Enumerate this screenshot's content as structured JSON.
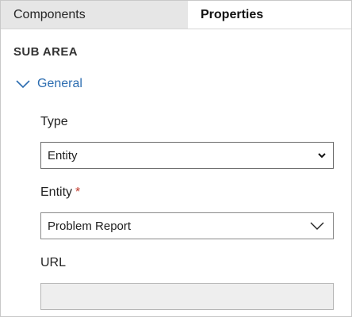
{
  "tabs": {
    "components_label": "Components",
    "properties_label": "Properties"
  },
  "section": {
    "title": "SUB AREA"
  },
  "group": {
    "title": "General",
    "chevron_icon": "chevron-down-icon"
  },
  "fields": {
    "type": {
      "label": "Type",
      "value": "Entity",
      "icon": "caret-down-icon"
    },
    "entity": {
      "label": "Entity",
      "required_marker": "*",
      "value": "Problem Report",
      "icon": "chevron-down-icon"
    },
    "url": {
      "label": "URL",
      "value": ""
    }
  },
  "colors": {
    "accent": "#2b6cb0",
    "required": "#c0392b",
    "tab_inactive_bg": "#e6e6e6",
    "disabled_bg": "#eeeeee"
  }
}
